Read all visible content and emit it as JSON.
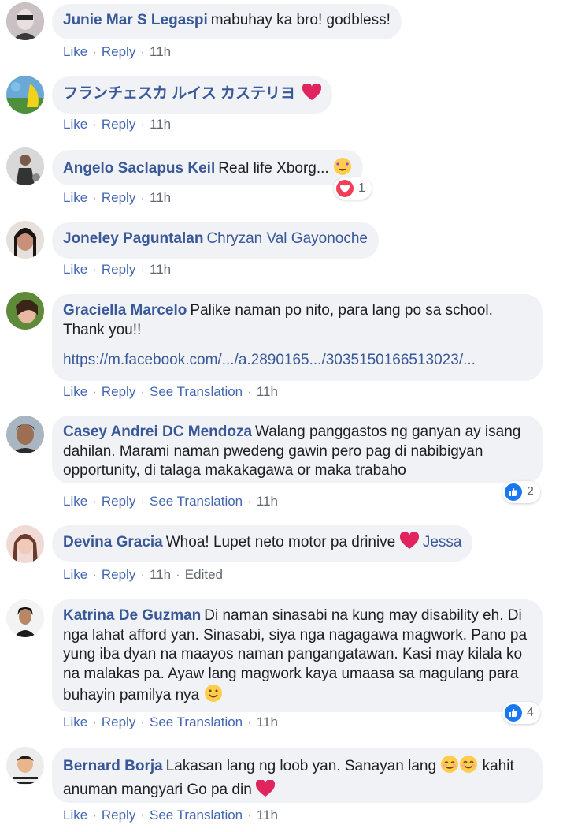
{
  "comments": [
    {
      "author": "Junie Mar S Legaspi",
      "text": "mabuhay ka bro! godbless!",
      "like": "Like",
      "reply": "Reply",
      "time": "11h"
    },
    {
      "author": "フランチェスカ ルイス カステリヨ",
      "text": "",
      "like": "Like",
      "reply": "Reply",
      "time": "11h",
      "emoji": "red-heart"
    },
    {
      "author": "Angelo Saclapus Keil",
      "text": "Real life Xborg...",
      "like": "Like",
      "reply": "Reply",
      "time": "11h",
      "emoji": "star-struck",
      "reaction": {
        "type": "love",
        "count": "1"
      }
    },
    {
      "author": "Joneley Paguntalan",
      "mention": "Chryzan Val Gayonoche",
      "like": "Like",
      "reply": "Reply",
      "time": "11h"
    },
    {
      "author": "Graciella Marcelo",
      "text": "Palike naman po nito, para lang po sa school. Thank you!!",
      "link": "https://m.facebook.com/.../a.2890165.../303515016651302​3/...",
      "like": "Like",
      "reply": "Reply",
      "translate": "See Translation",
      "time": "11h"
    },
    {
      "author": "Casey Andrei DC Mendoza",
      "text": "Walang panggastos ng ganyan ay isang dahilan. Marami naman pwedeng gawin pero pag di nabibigyan opportunity, di talaga makakagawa or maka trabaho",
      "like": "Like",
      "reply": "Reply",
      "translate": "See Translation",
      "time": "11h",
      "reaction": {
        "type": "like",
        "count": "2"
      }
    },
    {
      "author": "Devina Gracia",
      "text": "Whoa! Lupet neto motor pa drinive",
      "mention": "Jessa",
      "like": "Like",
      "reply": "Reply",
      "time": "11h",
      "edited": "Edited",
      "emoji": "red-heart"
    },
    {
      "author": "Katrina De Guzman",
      "text": "Di naman sinasabi na kung may disability eh. Di nga lahat afford yan. Sinasabi, siya nga nagagawa magwork. Pano pa yung iba dyan na maayos naman pangangatawan. Kasi may kilala ko na malakas pa. Ayaw lang magwork kaya umaasa sa magulang para buhayin pamilya nya",
      "like": "Like",
      "reply": "Reply",
      "translate": "See Translation",
      "time": "11h",
      "emoji": "smiling-face",
      "reaction": {
        "type": "like",
        "count": "4"
      }
    },
    {
      "author": "Bernard Borja",
      "text": "Lakasan lang ng loob yan. Sanayan lang",
      "text2": "kahit anuman mangyari Go pa din",
      "like": "Like",
      "reply": "Reply",
      "translate": "See Translation",
      "time": "11h",
      "emoji": "blush-faces-and-red-heart"
    }
  ],
  "colors": {
    "author": "#385898",
    "bubble": "#f0f2f5",
    "action": "#4267b2",
    "love": "#f33e58",
    "like": "#1877f2"
  }
}
